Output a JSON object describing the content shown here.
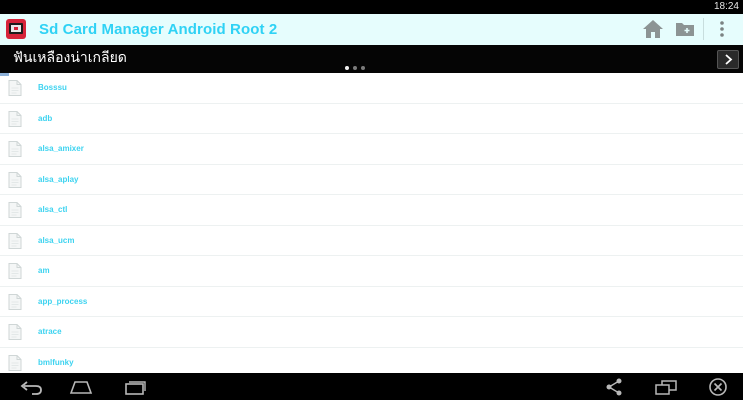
{
  "status_bar": {
    "time": "18:24"
  },
  "action_bar": {
    "title": "Sd Card Manager Android Root 2",
    "buttons": [
      "home-icon",
      "folder-icon",
      "overflow-menu-icon"
    ]
  },
  "ad_banner": {
    "text": "ฟันเหลืองน่าเกลียด"
  },
  "file_list": {
    "items": [
      {
        "name": "Bosssu"
      },
      {
        "name": "adb"
      },
      {
        "name": "alsa_amixer"
      },
      {
        "name": "alsa_aplay"
      },
      {
        "name": "alsa_ctl"
      },
      {
        "name": "alsa_ucm"
      },
      {
        "name": "am"
      },
      {
        "name": "app_process"
      },
      {
        "name": "atrace"
      },
      {
        "name": "bmlfunky"
      }
    ]
  },
  "nav_bar": {
    "left_buttons": [
      "back-icon",
      "home-icon",
      "recent-apps-icon"
    ],
    "right_buttons": [
      "share-icon",
      "screen-resize-icon",
      "close-icon"
    ]
  },
  "colors": {
    "action_bar_bg": "#e6fdfd",
    "title_accent": "#2fd2f5",
    "file_name": "#3dd3f0",
    "bars": "#000000"
  }
}
